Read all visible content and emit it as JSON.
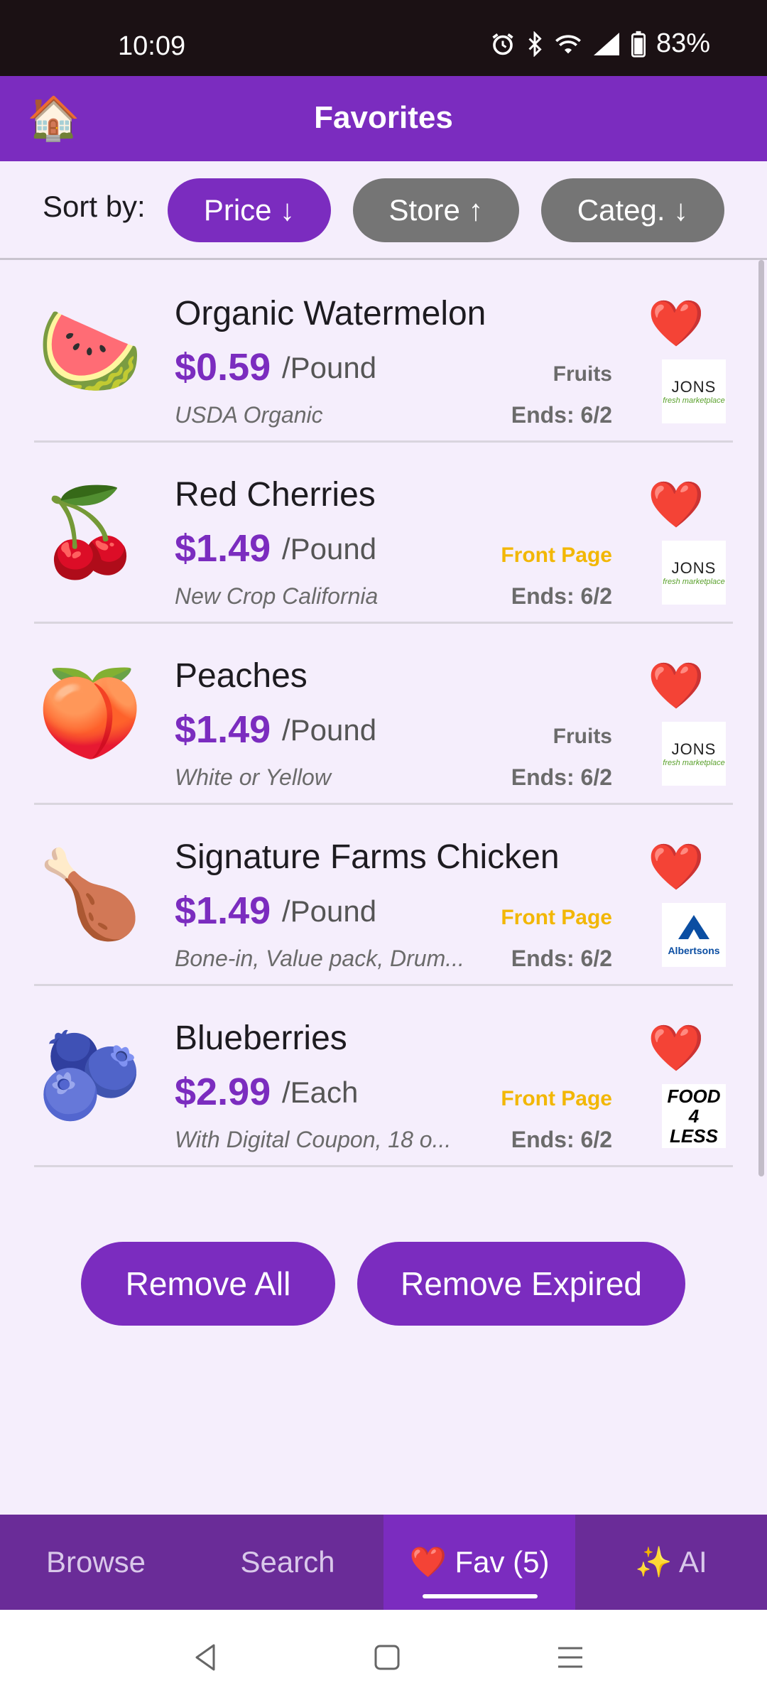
{
  "status_bar": {
    "time": "10:09",
    "battery": "83%"
  },
  "app_bar": {
    "title": "Favorites",
    "home_icon": "🏠"
  },
  "sort": {
    "label": "Sort by:",
    "chips": [
      {
        "label": "Price ↓",
        "active": true
      },
      {
        "label": "Store ↑",
        "active": false
      },
      {
        "label": "Categ. ↓",
        "active": false
      }
    ]
  },
  "items": [
    {
      "emoji": "🍉",
      "name": "Organic Watermelon",
      "price": "$0.59",
      "unit": "/Pound",
      "description": "USDA Organic",
      "tag": "Fruits",
      "tag_type": "category",
      "ends": "Ends: 6/2",
      "heart": "❤️",
      "store": "JONS"
    },
    {
      "emoji": "🍒",
      "name": "Red Cherries",
      "price": "$1.49",
      "unit": "/Pound",
      "description": "New Crop California",
      "tag": "Front Page",
      "tag_type": "front",
      "ends": "Ends: 6/2",
      "heart": "❤️",
      "store": "JONS"
    },
    {
      "emoji": "🍑",
      "name": "Peaches",
      "price": "$1.49",
      "unit": "/Pound",
      "description": "White or Yellow",
      "tag": "Fruits",
      "tag_type": "category",
      "ends": "Ends: 6/2",
      "heart": "❤️",
      "store": "JONS"
    },
    {
      "emoji": "🍗",
      "name": "Signature Farms Chicken",
      "price": "$1.49",
      "unit": "/Pound",
      "description": "Bone-in, Value pack, Drum...",
      "tag": "Front Page",
      "tag_type": "front",
      "ends": "Ends: 6/2",
      "heart": "❤️",
      "store": "Albertsons"
    },
    {
      "emoji": "🫐",
      "name": "Blueberries",
      "price": "$2.99",
      "unit": "/Each",
      "description": "With Digital Coupon, 18 o...",
      "tag": "Front Page",
      "tag_type": "front",
      "ends": "Ends: 6/2",
      "heart": "❤️",
      "store": "Food 4 Less"
    }
  ],
  "store_logos": {
    "jons_main": "JONS",
    "jons_sub": "fresh marketplace",
    "albertsons": "Albertsons",
    "food4less_line1": "FOOD 4",
    "food4less_line2": "LESS"
  },
  "actions": {
    "remove_all": "Remove All",
    "remove_expired": "Remove Expired"
  },
  "bottom_nav": [
    {
      "label": "Browse",
      "active": false
    },
    {
      "label": "Search",
      "active": false
    },
    {
      "label": "❤️ Fav (5)",
      "active": true
    },
    {
      "label": "✨ AI",
      "active": false
    }
  ],
  "colors": {
    "primary": "#7b2cbf",
    "nav_bg": "#6a2c98",
    "front_page": "#f2b705",
    "background": "#f5eefc"
  }
}
